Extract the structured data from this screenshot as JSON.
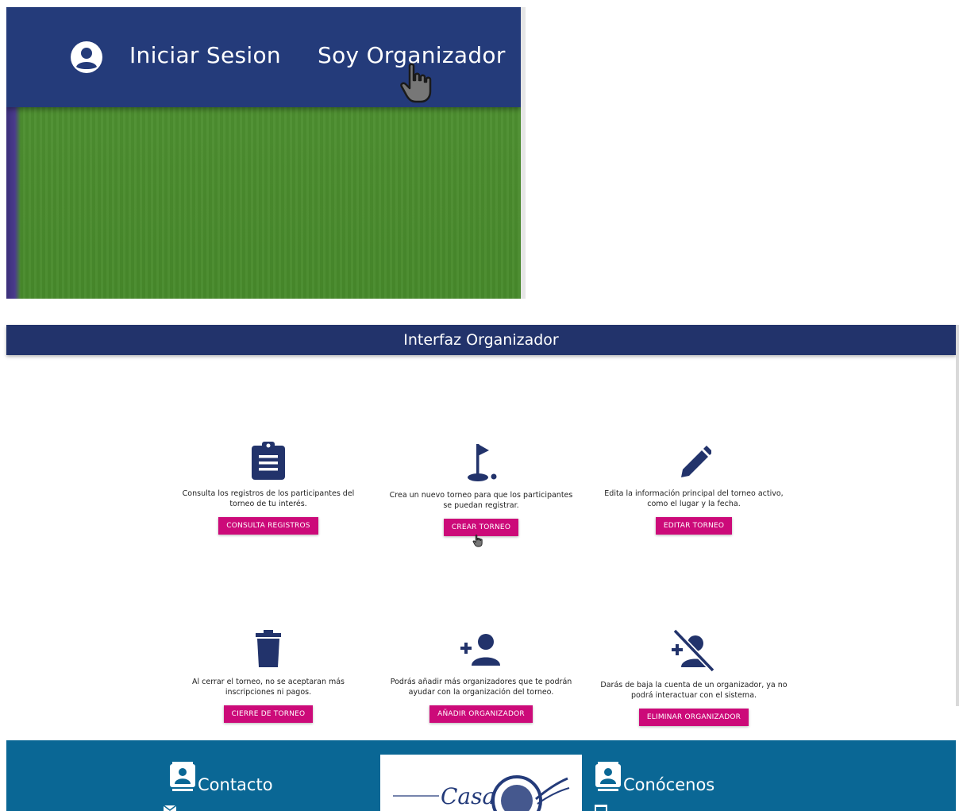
{
  "inset": {
    "login_label": "Iniciar Sesion",
    "organizer_label": "Soy Organizador"
  },
  "header": {
    "title": "Interfaz Organizador"
  },
  "cards": [
    {
      "icon": "clipboard-icon",
      "description": "Consulta los registros de los participantes del torneo de tu interés.",
      "button": "CONSULTA REGISTROS"
    },
    {
      "icon": "golf-flag-icon",
      "description": "Crea un nuevo torneo para que los participantes se puedan registrar.",
      "button": "CREAR TORNEO"
    },
    {
      "icon": "pencil-icon",
      "description": "Edita la información principal del torneo activo, como el lugar y la fecha.",
      "button": "EDITAR TORNEO"
    },
    {
      "icon": "trash-icon",
      "description": "Al cerrar el torneo, no se aceptaran más inscripciones ni pagos.",
      "button": "CIERRE DE TORNEO"
    },
    {
      "icon": "person-add-icon",
      "description": "Podrás añadir más organizadores que te podrán ayudar con la organización del torneo.",
      "button": "AÑADIR ORGANIZADOR"
    },
    {
      "icon": "person-remove-icon",
      "description": "Darás de baja la cuenta de un organizador, ya no podrá interactuar con el sistema.",
      "button": "ELIMINAR ORGANIZADOR"
    }
  ],
  "footer": {
    "contact_title": "Contacto",
    "about_title": "Conócenos",
    "logo_text": "Casa"
  },
  "colors": {
    "nav": "#22336b",
    "accent": "#cc0a79",
    "footer": "#0a6795"
  }
}
